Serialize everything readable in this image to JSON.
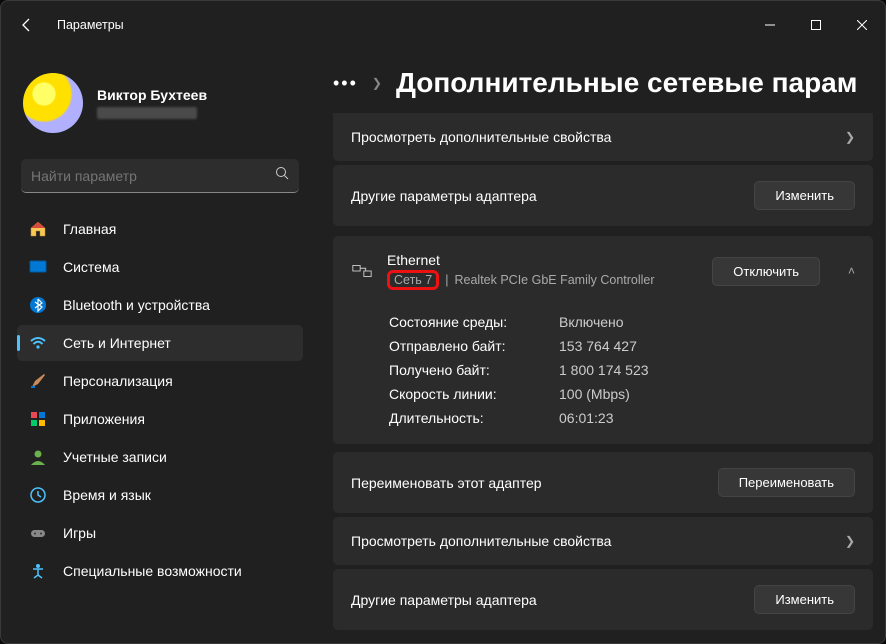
{
  "window": {
    "title": "Параметры"
  },
  "profile": {
    "name": "Виктор Бухтеев"
  },
  "search": {
    "placeholder": "Найти параметр"
  },
  "nav": [
    {
      "id": "home",
      "label": "Главная",
      "icon": "home"
    },
    {
      "id": "system",
      "label": "Система",
      "icon": "system"
    },
    {
      "id": "bluetooth",
      "label": "Bluetooth и устройства",
      "icon": "bluetooth"
    },
    {
      "id": "network",
      "label": "Сеть и Интернет",
      "icon": "wifi",
      "active": true
    },
    {
      "id": "personal",
      "label": "Персонализация",
      "icon": "brush"
    },
    {
      "id": "apps",
      "label": "Приложения",
      "icon": "apps"
    },
    {
      "id": "accounts",
      "label": "Учетные записи",
      "icon": "account"
    },
    {
      "id": "time",
      "label": "Время и язык",
      "icon": "time"
    },
    {
      "id": "gaming",
      "label": "Игры",
      "icon": "gaming"
    },
    {
      "id": "access",
      "label": "Специальные возможности",
      "icon": "access"
    }
  ],
  "page": {
    "title": "Дополнительные сетевые парам"
  },
  "rows": {
    "view_props": "Просмотреть дополнительные свойства",
    "other_adapter": "Другие параметры адаптера",
    "change": "Изменить",
    "rename_adapter": "Переименовать этот адаптер",
    "rename": "Переименовать"
  },
  "adapter": {
    "name": "Ethernet",
    "network": "Сеть 7",
    "hw": "Realtek PCIe GbE Family Controller",
    "disable": "Отключить",
    "stats": {
      "status_lbl": "Состояние среды:",
      "status": "Включено",
      "sent_lbl": "Отправлено байт:",
      "sent": "153 764 427",
      "recv_lbl": "Получено байт:",
      "recv": "1 800 174 523",
      "speed_lbl": "Скорость линии:",
      "speed": "100 (Mbps)",
      "dur_lbl": "Длительность:",
      "dur": "06:01:23"
    }
  }
}
